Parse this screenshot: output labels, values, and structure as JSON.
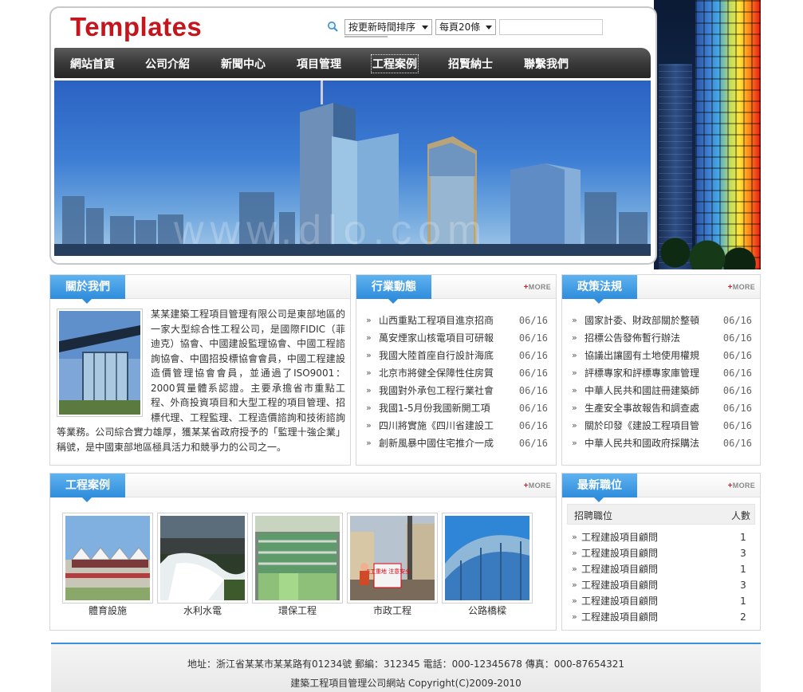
{
  "header": {
    "logo": "Templates",
    "sort_select": "按更新時間排序",
    "per_page_select": "每頁20條",
    "search_value": ""
  },
  "nav": [
    "網站首頁",
    "公司介紹",
    "新聞中心",
    "項目管理",
    "工程案例",
    "招賢納士",
    "聯繫我們"
  ],
  "banner": {
    "watermark": "www.dlo.com"
  },
  "more_label": "MORE",
  "about": {
    "title": "關於我們",
    "text": "某某建築工程項目管理有限公司是東部地區的一家大型綜合性工程公司，是國際FIDIC（菲迪克）協會、中國建設監理協會、中國工程諮詢協會、中國招投標協會會員，中國工程建設造價管理協會會員，並通過了ISO9001：2000質量體系認證。主要承擔省市重點工程、外商投資項目和大型工程的項目管理、招標代理、工程監理、工程造價諮詢和技術諮詢等業務。公司綜合實力雄厚，獲某某省政府授予的「監理十強企業」稱號，是中國東部地區極具活力和競爭力的公司之一。"
  },
  "industry": {
    "title": "行業動態",
    "items": [
      {
        "text": "山西重點工程項目進京招商",
        "date": "06/16"
      },
      {
        "text": "萬安煙家山核電項目可研報",
        "date": "06/16"
      },
      {
        "text": "我國大陸首座自行設計海底",
        "date": "06/16"
      },
      {
        "text": "北京市將健全保障性住房質",
        "date": "06/16"
      },
      {
        "text": "我國對外承包工程行業社會",
        "date": "06/16"
      },
      {
        "text": "我國1-5月份我國新開工項",
        "date": "06/16"
      },
      {
        "text": "四川將實施《四川省建設工",
        "date": "06/16"
      },
      {
        "text": "創新風暴中國住宅推介一成",
        "date": "06/16"
      }
    ]
  },
  "policy": {
    "title": "政策法規",
    "items": [
      {
        "text": "國家計委、財政部關於整頓",
        "date": "06/16"
      },
      {
        "text": "招標公告發佈暫行辦法",
        "date": "06/16"
      },
      {
        "text": "協議出讓國有土地使用權規",
        "date": "06/16"
      },
      {
        "text": "評標專家和評標專家庫管理",
        "date": "06/16"
      },
      {
        "text": "中華人民共和國註冊建築師",
        "date": "06/16"
      },
      {
        "text": "生產安全事故報告和調查處",
        "date": "06/16"
      },
      {
        "text": "關於印發《建設工程項目管",
        "date": "06/16"
      },
      {
        "text": "中華人民共和國政府採購法",
        "date": "06/16"
      }
    ]
  },
  "cases": {
    "title": "工程案例",
    "items": [
      "體育設施",
      "水利水電",
      "環保工程",
      "市政工程",
      "公路橋樑"
    ],
    "sign_text": "施工重地 注意安全"
  },
  "jobs": {
    "title": "最新職位",
    "col_position": "招聘職位",
    "col_count": "人數",
    "items": [
      {
        "title": "工程建設項目顧問",
        "count": "1"
      },
      {
        "title": "工程建設項目顧問",
        "count": "3"
      },
      {
        "title": "工程建設項目顧問",
        "count": "1"
      },
      {
        "title": "工程建設項目顧問",
        "count": "3"
      },
      {
        "title": "工程建設項目顧問",
        "count": "1"
      },
      {
        "title": "工程建設項目顧問",
        "count": "2"
      }
    ]
  },
  "footer": {
    "line1": "地址：浙江省某某市某某路有01234號 郵編：312345 電話：000-12345678 傳真：000-87654321",
    "line2": "建築工程項目管理公司網站 Copyright(C)2009-2010"
  },
  "colors": {
    "logo": "#c4161c",
    "accent_blue": "#2f8ddc",
    "nav_bg": "#333333"
  }
}
